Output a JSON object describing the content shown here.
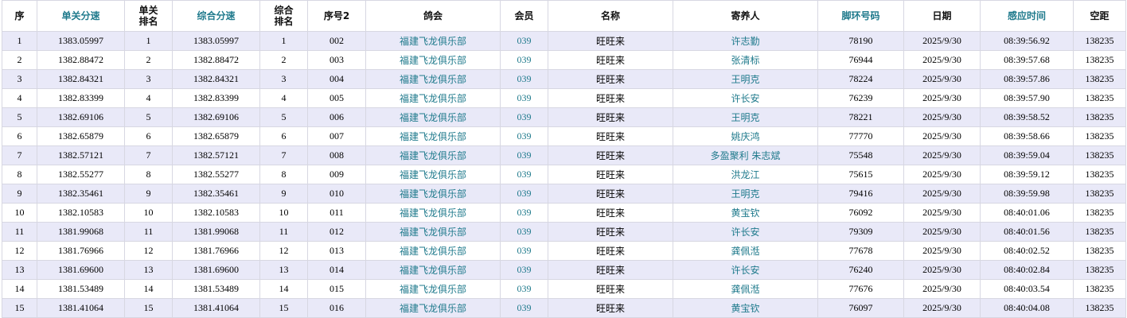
{
  "table": {
    "columns": [
      {
        "label": "序",
        "sortable": false,
        "width": 44
      },
      {
        "label": "单关分速",
        "sortable": true,
        "width": 110
      },
      {
        "label": "单关\n排名",
        "sortable": false,
        "width": 60
      },
      {
        "label": "综合分速",
        "sortable": true,
        "width": 110
      },
      {
        "label": "综合\n排名",
        "sortable": false,
        "width": 60
      },
      {
        "label": "序号2",
        "sortable": false,
        "width": 73
      },
      {
        "label": "鸽会",
        "sortable": false,
        "width": 169
      },
      {
        "label": "会员",
        "sortable": false,
        "width": 60
      },
      {
        "label": "名称",
        "sortable": false,
        "width": 157
      },
      {
        "label": "寄养人",
        "sortable": false,
        "width": 182
      },
      {
        "label": "脚环号码",
        "sortable": true,
        "width": 108
      },
      {
        "label": "日期",
        "sortable": false,
        "width": 96
      },
      {
        "label": "感应时间",
        "sortable": true,
        "width": 117
      },
      {
        "label": "空距",
        "sortable": false,
        "width": 66
      }
    ],
    "rows": [
      [
        "1",
        "1383.05997",
        "1",
        "1383.05997",
        "1",
        "002",
        "福建飞龙俱乐部",
        "039",
        "旺旺来",
        "许志勤",
        "78190",
        "2025/9/30",
        "08:39:56.92",
        "138235"
      ],
      [
        "2",
        "1382.88472",
        "2",
        "1382.88472",
        "2",
        "003",
        "福建飞龙俱乐部",
        "039",
        "旺旺来",
        "张清标",
        "76944",
        "2025/9/30",
        "08:39:57.68",
        "138235"
      ],
      [
        "3",
        "1382.84321",
        "3",
        "1382.84321",
        "3",
        "004",
        "福建飞龙俱乐部",
        "039",
        "旺旺来",
        "王明克",
        "78224",
        "2025/9/30",
        "08:39:57.86",
        "138235"
      ],
      [
        "4",
        "1382.83399",
        "4",
        "1382.83399",
        "4",
        "005",
        "福建飞龙俱乐部",
        "039",
        "旺旺来",
        "许长安",
        "76239",
        "2025/9/30",
        "08:39:57.90",
        "138235"
      ],
      [
        "5",
        "1382.69106",
        "5",
        "1382.69106",
        "5",
        "006",
        "福建飞龙俱乐部",
        "039",
        "旺旺来",
        "王明克",
        "78221",
        "2025/9/30",
        "08:39:58.52",
        "138235"
      ],
      [
        "6",
        "1382.65879",
        "6",
        "1382.65879",
        "6",
        "007",
        "福建飞龙俱乐部",
        "039",
        "旺旺来",
        "姚庆鸿",
        "77770",
        "2025/9/30",
        "08:39:58.66",
        "138235"
      ],
      [
        "7",
        "1382.57121",
        "7",
        "1382.57121",
        "7",
        "008",
        "福建飞龙俱乐部",
        "039",
        "旺旺来",
        "多盈聚利 朱志斌",
        "75548",
        "2025/9/30",
        "08:39:59.04",
        "138235"
      ],
      [
        "8",
        "1382.55277",
        "8",
        "1382.55277",
        "8",
        "009",
        "福建飞龙俱乐部",
        "039",
        "旺旺来",
        "洪龙江",
        "75615",
        "2025/9/30",
        "08:39:59.12",
        "138235"
      ],
      [
        "9",
        "1382.35461",
        "9",
        "1382.35461",
        "9",
        "010",
        "福建飞龙俱乐部",
        "039",
        "旺旺来",
        "王明克",
        "79416",
        "2025/9/30",
        "08:39:59.98",
        "138235"
      ],
      [
        "10",
        "1382.10583",
        "10",
        "1382.10583",
        "10",
        "011",
        "福建飞龙俱乐部",
        "039",
        "旺旺来",
        "黄宝钦",
        "76092",
        "2025/9/30",
        "08:40:01.06",
        "138235"
      ],
      [
        "11",
        "1381.99068",
        "11",
        "1381.99068",
        "11",
        "012",
        "福建飞龙俱乐部",
        "039",
        "旺旺来",
        "许长安",
        "79309",
        "2025/9/30",
        "08:40:01.56",
        "138235"
      ],
      [
        "12",
        "1381.76966",
        "12",
        "1381.76966",
        "12",
        "013",
        "福建飞龙俱乐部",
        "039",
        "旺旺来",
        "龚佩湉",
        "77678",
        "2025/9/30",
        "08:40:02.52",
        "138235"
      ],
      [
        "13",
        "1381.69600",
        "13",
        "1381.69600",
        "13",
        "014",
        "福建飞龙俱乐部",
        "039",
        "旺旺来",
        "许长安",
        "76240",
        "2025/9/30",
        "08:40:02.84",
        "138235"
      ],
      [
        "14",
        "1381.53489",
        "14",
        "1381.53489",
        "14",
        "015",
        "福建飞龙俱乐部",
        "039",
        "旺旺来",
        "龚佩湉",
        "77676",
        "2025/9/30",
        "08:40:03.54",
        "138235"
      ],
      [
        "15",
        "1381.41064",
        "15",
        "1381.41064",
        "15",
        "016",
        "福建飞龙俱乐部",
        "039",
        "旺旺来",
        "黄宝钦",
        "76097",
        "2025/9/30",
        "08:40:04.08",
        "138235"
      ]
    ]
  }
}
